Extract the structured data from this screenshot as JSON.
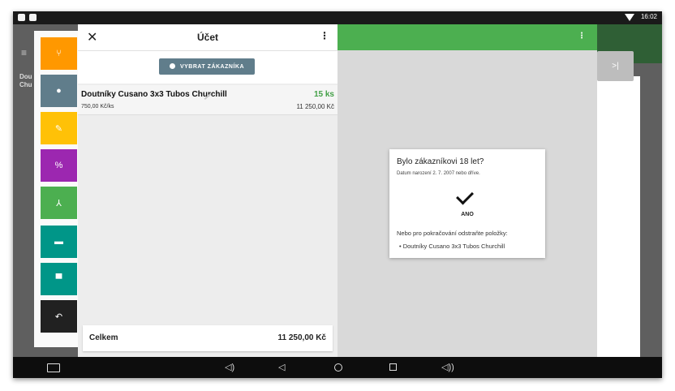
{
  "status_bar": {
    "time": "16:02"
  },
  "background": {
    "left_text_line1": "Dou",
    "left_text_line2": "Chu",
    "skip_label": ">|"
  },
  "tools": [
    {
      "icon": "fork-icon",
      "glyph": "⑂",
      "color": "#ff9800"
    },
    {
      "icon": "person-icon",
      "glyph": "●",
      "color": "#607d8b"
    },
    {
      "icon": "pencil-icon",
      "glyph": "✎",
      "color": "#ffc107"
    },
    {
      "icon": "percent-icon",
      "glyph": "%",
      "color": "#9c27b0"
    },
    {
      "icon": "merge-icon",
      "glyph": "⅄",
      "color": "#4caf50"
    },
    {
      "icon": "store-icon",
      "glyph": "▬",
      "color": "#009688"
    },
    {
      "icon": "car-icon",
      "glyph": "▀",
      "color": "#009688"
    },
    {
      "icon": "undo-icon",
      "glyph": "↶",
      "color": "#212121"
    }
  ],
  "cart": {
    "title": "Účet",
    "close_glyph": "✕",
    "menu_glyph": "⋮",
    "customer_button": "VYBRAT ZÁKAZNÍKA",
    "item": {
      "name": "Doutníky Cusano 3x3 Tubos Churchill",
      "qty": "15 ks",
      "unit_price": "750,00 Kč/ks",
      "total": "11 250,00 Kč"
    },
    "total_label": "Celkem",
    "total_value": "11 250,00 Kč"
  },
  "right_menu_glyph": "⋮",
  "dialog": {
    "title": "Bylo zákazníkovi 18 let?",
    "subtitle": "Datum narození 2. 7. 2007 nebo dříve.",
    "yes_label": "ANO",
    "note": "Nebo pro pokračování odstraňte položky:",
    "item": "• Doutníky Cusano 3x3 Tubos Churchill"
  },
  "nav": {
    "volume_down": "◁)",
    "back": "◁",
    "volume_up": "◁))"
  }
}
